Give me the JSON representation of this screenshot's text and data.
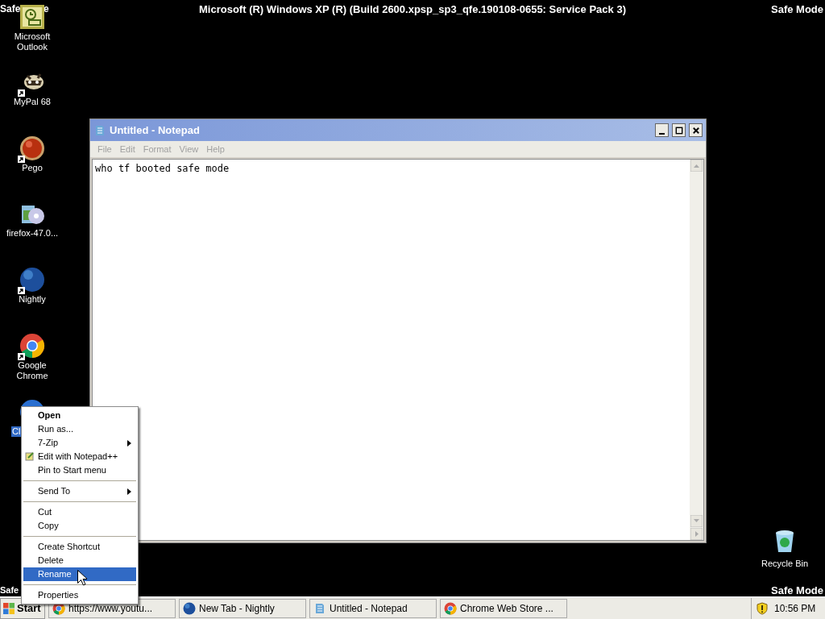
{
  "banner": {
    "title": "Microsoft (R) Windows XP (R) (Build 2600.xpsp_sp3_qfe.190108-0655: Service Pack 3)",
    "corners": {
      "top_left": [
        "Safe",
        "e"
      ],
      "top_right": "Safe Mode",
      "bottom_left": "Safe",
      "bottom_right": "Safe Mode"
    }
  },
  "desktop_icons": [
    {
      "kind": "outlook",
      "label": "Microsoft Outlook",
      "selected": false
    },
    {
      "kind": "raccoon",
      "label": "MyPal 68",
      "selected": false
    },
    {
      "kind": "pego",
      "label": "Pego",
      "selected": false
    },
    {
      "kind": "installer",
      "label": "firefox-47.0...",
      "selected": false
    },
    {
      "kind": "nightly",
      "label": "Nightly",
      "selected": false
    },
    {
      "kind": "chrome",
      "label": "Google Chrome",
      "selected": false
    },
    {
      "kind": "hidden",
      "label": "Cl",
      "selected": true
    }
  ],
  "recycle_bin": {
    "label": "Recycle Bin"
  },
  "notepad": {
    "title": "Untitled - Notepad",
    "menu": [
      "File",
      "Edit",
      "Format",
      "View",
      "Help"
    ],
    "text": "who tf booted safe mode"
  },
  "context_menu": {
    "items": [
      {
        "kind": "item",
        "label": "Open",
        "default": true,
        "selected": false
      },
      {
        "kind": "item",
        "label": "Run as...",
        "selected": false
      },
      {
        "kind": "submenu",
        "label": "7-Zip",
        "selected": false
      },
      {
        "kind": "notepadpp",
        "label": "Edit with Notepad++",
        "selected": false
      },
      {
        "kind": "item",
        "label": "Pin to Start menu",
        "selected": false
      },
      {
        "kind": "separator"
      },
      {
        "kind": "submenu",
        "label": "Send To",
        "selected": false
      },
      {
        "kind": "separator"
      },
      {
        "kind": "item",
        "label": "Cut",
        "selected": false
      },
      {
        "kind": "item",
        "label": "Copy",
        "selected": false
      },
      {
        "kind": "separator"
      },
      {
        "kind": "item",
        "label": "Create Shortcut",
        "selected": false
      },
      {
        "kind": "item",
        "label": "Delete",
        "selected": false
      },
      {
        "kind": "item",
        "label": "Rename",
        "selected": true
      },
      {
        "kind": "separator"
      },
      {
        "kind": "item",
        "label": "Properties",
        "selected": false
      }
    ]
  },
  "taskbar": {
    "start": "Start",
    "tasks": [
      {
        "kind": "chrome",
        "label": "https://www.youtu..."
      },
      {
        "kind": "nightly",
        "label": "New Tab - Nightly"
      },
      {
        "kind": "notepad",
        "label": "Untitled - Notepad"
      },
      {
        "kind": "chrome",
        "label": "Chrome Web Store ..."
      }
    ],
    "clock": "10:56 PM"
  }
}
